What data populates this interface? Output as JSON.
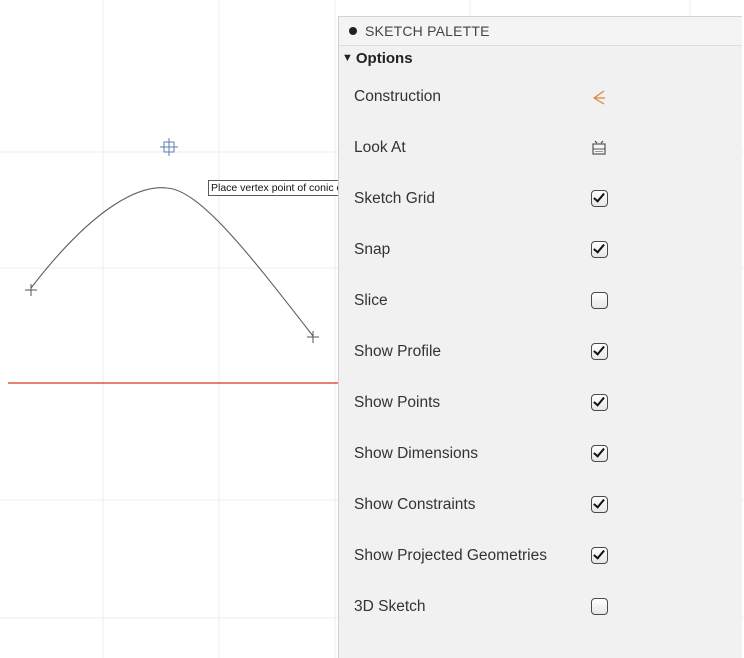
{
  "tooltip": "Place vertex point of conic curve",
  "palette": {
    "title": "SKETCH PALETTE",
    "section_arrow": "▼",
    "section_label": "Options",
    "rows": [
      {
        "label": "Construction",
        "control": "construction-icon"
      },
      {
        "label": "Look At",
        "control": "look-at-icon"
      },
      {
        "label": "Sketch Grid",
        "control": "checkbox",
        "checked": true
      },
      {
        "label": "Snap",
        "control": "checkbox",
        "checked": true
      },
      {
        "label": "Slice",
        "control": "checkbox",
        "checked": false
      },
      {
        "label": "Show Profile",
        "control": "checkbox",
        "checked": true
      },
      {
        "label": "Show Points",
        "control": "checkbox",
        "checked": true
      },
      {
        "label": "Show Dimensions",
        "control": "checkbox",
        "checked": true
      },
      {
        "label": "Show Constraints",
        "control": "checkbox",
        "checked": true
      },
      {
        "label": "Show Projected Geometries",
        "control": "checkbox",
        "checked": true
      },
      {
        "label": "3D Sketch",
        "control": "checkbox",
        "checked": false
      }
    ]
  },
  "colors": {
    "axis_red": "#e05a3a",
    "curve": "#6b5a57",
    "grid": "#e8e8e8",
    "construction_icon": "#d9883a"
  }
}
